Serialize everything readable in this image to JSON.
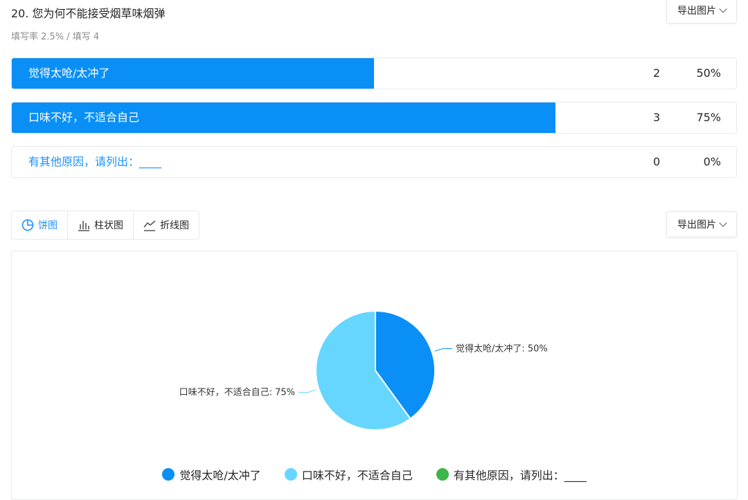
{
  "question": {
    "title": "20. 您为何不能接受烟草味烟弹",
    "meta": "填写率 2.5% / 填写 4"
  },
  "export_label": "导出图片",
  "options": [
    {
      "label": "觉得太呛/太冲了",
      "count": "2",
      "percent": "50%",
      "fill": 0.5
    },
    {
      "label": "口味不好，不适合自己",
      "count": "3",
      "percent": "75%",
      "fill": 0.75
    },
    {
      "label": "有其他原因，请列出：____",
      "count": "0",
      "percent": "0%",
      "fill": 0
    }
  ],
  "tabs": [
    {
      "label": "饼图",
      "icon": "pie-chart-icon"
    },
    {
      "label": "柱状图",
      "icon": "bar-chart-icon"
    },
    {
      "label": "折线图",
      "icon": "line-chart-icon"
    }
  ],
  "colors": {
    "accent": "#1890ff",
    "bar": "#0a8ff7",
    "series": [
      "#0a8ff7",
      "#66d6ff",
      "#3cb54a"
    ]
  },
  "chart_data": {
    "type": "pie",
    "categories": [
      "觉得太呛/太冲了",
      "口味不好，不适合自己",
      "有其他原因，请列出：____"
    ],
    "values": [
      2,
      3,
      0
    ],
    "slice_labels": [
      "觉得太呛/太冲了: 50%",
      "口味不好，不适合自己: 75%",
      ""
    ],
    "legend": "bottom"
  }
}
